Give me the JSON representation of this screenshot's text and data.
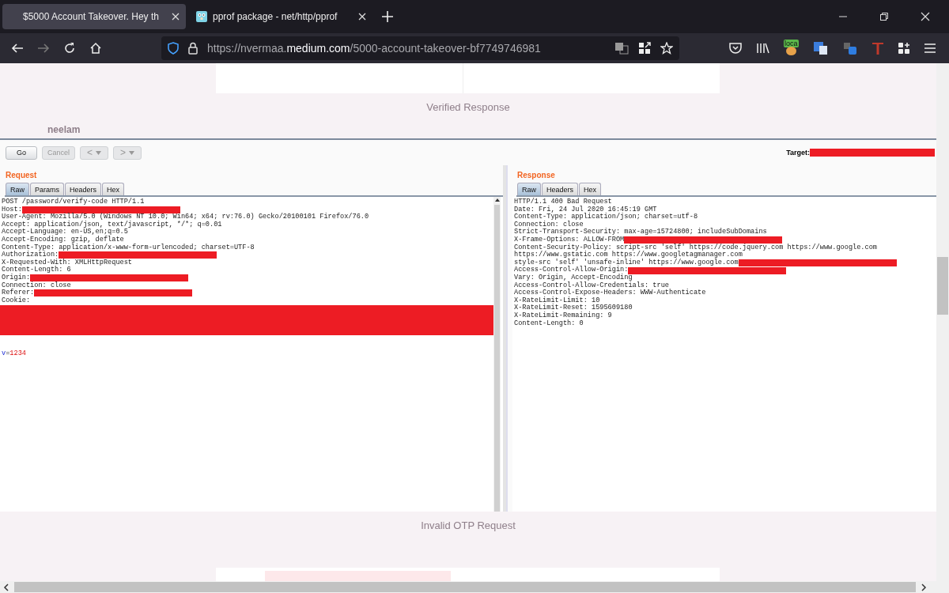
{
  "browser_tabs": [
    {
      "title": "$5000 Account Takeover. Hey th",
      "selected": true,
      "kind": "plain"
    },
    {
      "title": "pprof package - net/http/pprof",
      "selected": false,
      "kind": "gopher"
    }
  ],
  "address_bar": {
    "url_parts": [
      {
        "text": "https://nvermaa.",
        "highlighted": false
      },
      {
        "text": "medium.com",
        "highlighted": true
      },
      {
        "text": "/5000-account-takeover-bf7749746981",
        "highlighted": false
      }
    ]
  },
  "extension_badge": "loca",
  "article": {
    "caption_top": "Verified Response",
    "author_overlay": "neelam",
    "caption_bottom": "Invalid OTP Request"
  },
  "burp": {
    "buttons": [
      {
        "label": "Go",
        "disabled": false,
        "kind": "text"
      },
      {
        "label": "Cancel",
        "disabled": true,
        "kind": "text"
      },
      {
        "label": "<",
        "disabled": true,
        "kind": "history"
      },
      {
        "label": ">",
        "disabled": true,
        "kind": "history"
      }
    ],
    "target_label": "Target:",
    "request": {
      "title": "Request",
      "tabs": [
        {
          "label": "Raw",
          "selected": true
        },
        {
          "label": "Params",
          "selected": false
        },
        {
          "label": "Headers",
          "selected": false
        },
        {
          "label": "Hex",
          "selected": false
        }
      ],
      "lines": [
        {
          "kind": "text",
          "text": "POST /password/verify-code HTTP/1.1",
          "redacted": false
        },
        {
          "kind": "text",
          "text": "Host:",
          "redacted": true
        },
        {
          "kind": "text",
          "text": "User-Agent: Mozilla/5.0 (Windows NT 10.0; Win64; x64; rv:76.0) Gecko/20100101 Firefox/76.0",
          "redacted": false
        },
        {
          "kind": "text",
          "text": "Accept: application/json, text/javascript, */*; q=0.01",
          "redacted": false
        },
        {
          "kind": "text",
          "text": "Accept-Language: en-US,en;q=0.5",
          "redacted": false
        },
        {
          "kind": "text",
          "text": "Accept-Encoding: gzip, deflate",
          "redacted": false
        },
        {
          "kind": "text",
          "text": "Content-Type: application/x-www-form-urlencoded; charset=UTF-8",
          "redacted": false
        },
        {
          "kind": "text",
          "text": "Authorization:",
          "redacted": true
        },
        {
          "kind": "text",
          "text": "X-Requested-With: XMLHttpRequest",
          "redacted": false
        },
        {
          "kind": "text",
          "text": "Content-Length: 6",
          "redacted": false
        },
        {
          "kind": "text",
          "text": "Origin:",
          "redacted": true
        },
        {
          "kind": "text",
          "text": "Connection: close",
          "redacted": false
        },
        {
          "kind": "text",
          "text": "Referer:",
          "redacted": true
        },
        {
          "kind": "text",
          "text": "Cookie:",
          "redacted": false
        },
        {
          "kind": "redacted-block"
        },
        {
          "kind": "blank"
        },
        {
          "kind": "param",
          "name": "v",
          "sep": "=",
          "value": "1234"
        }
      ]
    },
    "response": {
      "title": "Response",
      "tabs": [
        {
          "label": "Raw",
          "selected": true
        },
        {
          "label": "Headers",
          "selected": false
        },
        {
          "label": "Hex",
          "selected": false
        }
      ],
      "lines": [
        {
          "kind": "text",
          "text": "HTTP/1.1 400 Bad Request",
          "redacted": false
        },
        {
          "kind": "text",
          "text": "Date: Fri, 24 Jul 2020 16:45:19 GMT",
          "redacted": false
        },
        {
          "kind": "text",
          "text": "Content-Type: application/json; charset=utf-8",
          "redacted": false
        },
        {
          "kind": "text",
          "text": "Connection: close",
          "redacted": false
        },
        {
          "kind": "text",
          "text": "Strict-Transport-Security: max-age=15724800; includeSubDomains",
          "redacted": false
        },
        {
          "kind": "text",
          "text": "X-Frame-Options: ALLOW-FROM",
          "redacted": true
        },
        {
          "kind": "text",
          "text": "Content-Security-Policy: script-src 'self' https://code.jquery.com https://www.google.com",
          "redacted": false
        },
        {
          "kind": "text",
          "text": "https://www.gstatic.com https://www.googletagmanager.com",
          "redacted": false
        },
        {
          "kind": "text",
          "text": "style-src 'self' 'unsafe-inline' https://www.google.com",
          "redacted": true
        },
        {
          "kind": "text",
          "text": "Access-Control-Allow-Origin:",
          "redacted": true
        },
        {
          "kind": "text",
          "text": "Vary: Origin, Accept-Encoding",
          "redacted": false
        },
        {
          "kind": "text",
          "text": "Access-Control-Allow-Credentials: true",
          "redacted": false
        },
        {
          "kind": "text",
          "text": "Access-Control-Expose-Headers: WWW-Authenticate",
          "redacted": false
        },
        {
          "kind": "text",
          "text": "X-RateLimit-Limit: 10",
          "redacted": false
        },
        {
          "kind": "text",
          "text": "X-RateLimit-Reset: 1595609180",
          "redacted": false
        },
        {
          "kind": "text",
          "text": "X-RateLimit-Remaining: 9",
          "redacted": false
        },
        {
          "kind": "text",
          "text": "Content-Length: 0",
          "redacted": false
        }
      ]
    }
  }
}
